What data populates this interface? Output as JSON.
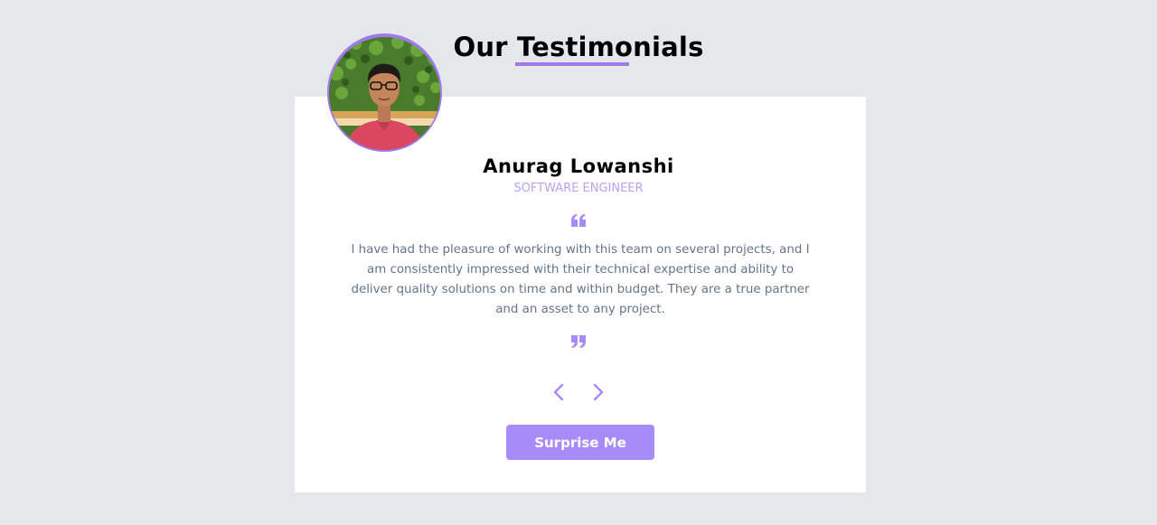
{
  "header": {
    "title_prefix": "Our ",
    "title_highlight": "Testimonials"
  },
  "testimonial": {
    "name": "Anurag Lowanshi",
    "job": "SOFTWARE ENGINEER",
    "text": "I have had the pleasure of working with this team on several projects, and I am consistently impressed with their technical expertise and ability to deliver quality solutions on time and within budget. They are a true partner and an asset to any project."
  },
  "icons": {
    "open_quote": "quote-left-icon",
    "close_quote": "quote-right-icon",
    "prev": "chevron-left-icon",
    "next": "chevron-right-icon"
  },
  "actions": {
    "surprise_label": "Surprise Me"
  },
  "colors": {
    "accent": "#9f7aea",
    "button": "#a78bfa",
    "background": "#e5e7eb",
    "card": "#ffffff",
    "job": "#b9a3f0",
    "text": "#64748b"
  }
}
